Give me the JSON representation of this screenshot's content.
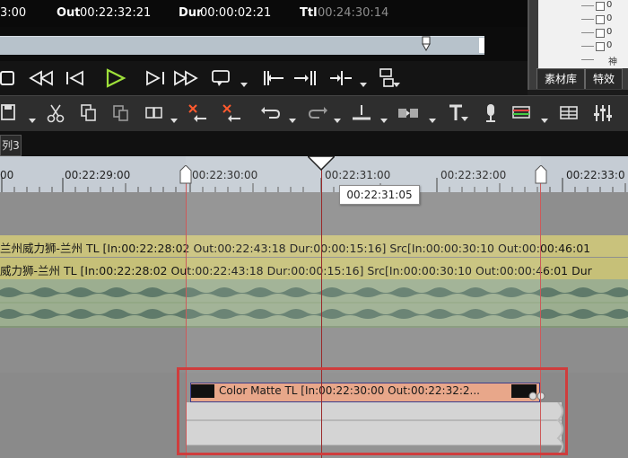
{
  "preview": {
    "tc_in_value": "3:00",
    "tc_out_label": "Out",
    "tc_out_value": "00:22:32:21",
    "tc_dur_label": "Dur",
    "tc_dur_value": "00:00:02:21",
    "tc_ttl_label": "Ttl",
    "tc_ttl_value": "00:24:30:14"
  },
  "right_panel": {
    "tabs": [
      "素材库",
      "特效"
    ],
    "tree_rows": [
      "0",
      "0",
      "0",
      "0",
      "0"
    ],
    "tree_last": "神"
  },
  "sequence_tab": "列3",
  "ruler": {
    "ticks": [
      "00",
      "00:22:29:00",
      "00:22:30:00",
      "00:22:31:00",
      "00:22:32:00",
      "00:22:33:0"
    ],
    "playhead_tooltip": "00:22:31:05"
  },
  "tracks": {
    "audio_clip_1": "兰州威力狮-兰州  TL [In:00:22:28:02  Out:00:22:43:18  Dur:00:00:15:16]  Src[In:00:00:30:10  Out:00:00:46:01",
    "audio_clip_2": "威力狮-兰州  TL [In:00:22:28:02  Out:00:22:43:18  Dur:00:00:15:16]  Src[In:00:00:30:10  Out:00:00:46:01  Dur",
    "color_matte": "Color Matte  TL [In:00:22:30:00  Out:00:22:32:2..."
  },
  "colors": {
    "accent_red": "#cf3d3d",
    "audio_clip": "#c9c27c",
    "color_matte": "#e8a78a",
    "ruler": "#c5ccd4"
  },
  "icons": {
    "transport": [
      "stop-icon",
      "rewind-icon",
      "step-back-icon",
      "play-icon",
      "step-forward-icon",
      "fast-forward-icon",
      "loop-icon",
      "mark-in-icon",
      "mark-out-icon",
      "split-icon",
      "sync-icon"
    ],
    "edit": [
      "save-icon",
      "cut-icon",
      "copy-icon",
      "paste-icon",
      "overwrite-icon",
      "delete-icon",
      "ripple-delete-icon",
      "undo-icon",
      "redo-icon",
      "level-icon",
      "transition-icon",
      "title-icon",
      "mic-icon",
      "render-icon",
      "grid-icon",
      "mixer-icon"
    ]
  }
}
